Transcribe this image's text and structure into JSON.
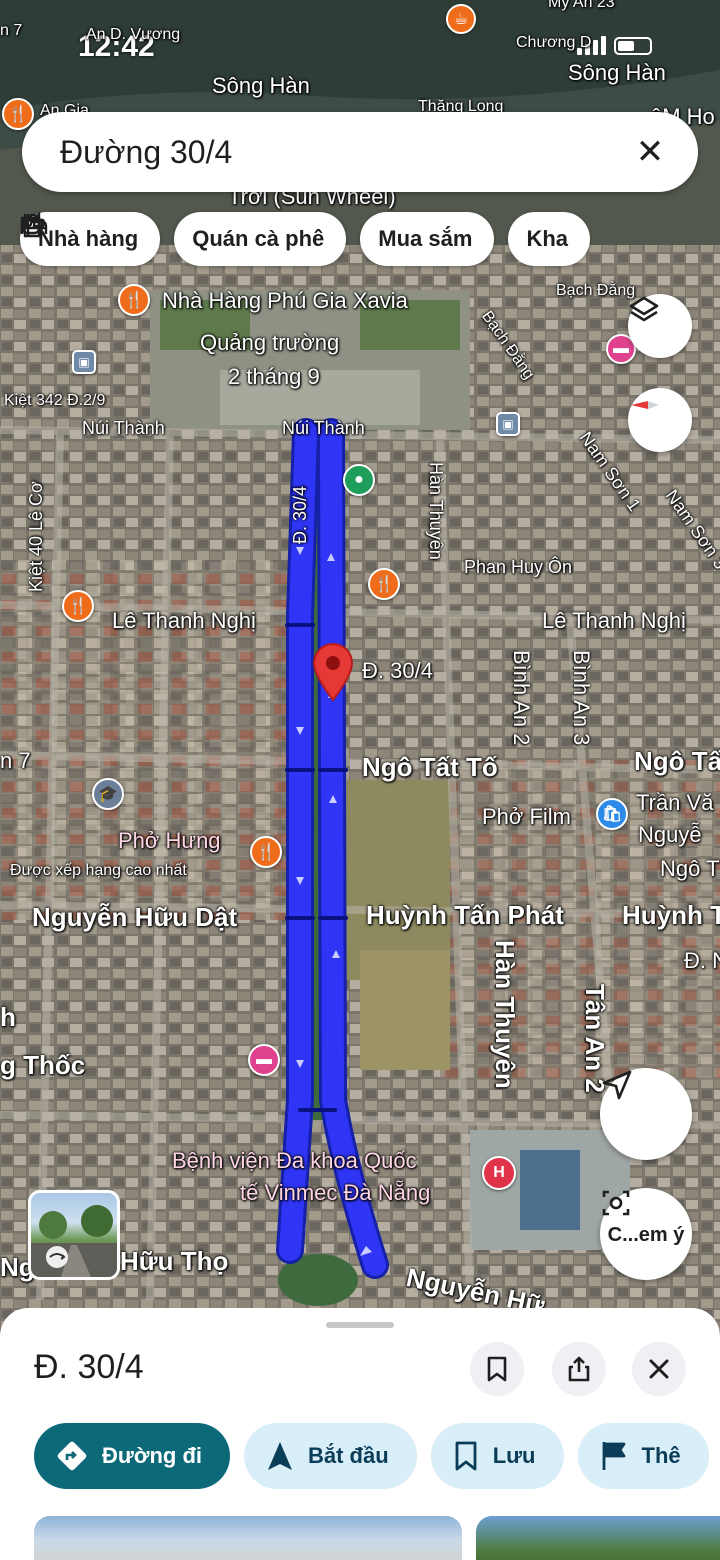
{
  "status": {
    "time": "12:42"
  },
  "search": {
    "query": "Đường 30/4",
    "clear_label": "✕"
  },
  "chips": [
    {
      "label": "Nhà hàng",
      "icon": "restaurant-icon"
    },
    {
      "label": "Quán cà phê",
      "icon": "coffee-icon"
    },
    {
      "label": "Mua sắm",
      "icon": "shopping-bag-icon"
    },
    {
      "label": "Kha",
      "icon": "bed-icon"
    }
  ],
  "map_labels": {
    "song_han_left": "Sông Hàn",
    "song_han_right": "Sông Hàn",
    "an_d_vuong": "An D. Vương",
    "my_an": "Mỹ An 23",
    "chuong_d": "Chương D",
    "an7_top": "n 7",
    "sun_wheel": "Trời (Sun Wheel)",
    "nha_hang_phu_gia": "Nhà Hàng Phú Gia Xavia",
    "bach_dang_top": "Bạch Đằng",
    "bach_dang_vert": "Bạch Đằng",
    "quang_truong_1": "Quảng trường",
    "quang_truong_2": "2 tháng 9",
    "kiet342": "Kiệt 342 Đ.2/9",
    "nui_thanh_left": "Núi Thành",
    "nui_thanh_center": "Núi Thành",
    "d304_vert": "Đ. 30/4",
    "kiet40": "Kiệt 40 Lê Cơ",
    "han_thuyen_top": "Hàn Thuyên",
    "nam_son_1": "Nam Sơn 1",
    "nam_son_3": "Nam Sơn 3",
    "phan_huy_on": "Phan Huy Ôn",
    "le_thanh_nghi_left": "Lê Thanh Nghị",
    "le_thanh_nghi_right": "Lê Thanh Nghị",
    "binh_an_2": "Bình An 2",
    "binh_an_3": "Bình An 3",
    "d304_pin": "Đ. 30/4",
    "an7_mid": "n 7",
    "ngo_tat_to": "Ngô Tất Tố",
    "ngo_tat_right": "Ngô Tấ",
    "pho_film": "Phở Film",
    "tran_va": "Trần Vă",
    "nguye": "Nguyễ",
    "ngo_t": "Ngô T",
    "pho_hung": "Phở Hưng",
    "duoc_xep_hang": "Được xếp hạng cao nhất",
    "nguyen_huu_dat": "Nguyễn Hữu Dật",
    "huynh_tan_phat": "Huỳnh Tấn Phát",
    "huynh_right": "Huỳnh T",
    "d_right": "Đ. N",
    "han_thuyen_bottom": "Hàn Thuyên",
    "tan_an": "Tân An 2",
    "g_thoc": "g Thốc",
    "h_left": "h",
    "benh_vien_1": "Bệnh viện Đa khoa Quốc",
    "benh_vien_2": "tế Vinmec Đà Nẵng",
    "huu_tho": "Hữu Thọ",
    "ng_left": "Ng",
    "nguyen_hu": "Nguyễn Hữ",
    "am_ho": "êM Ho",
    "an_gia": "An Gia",
    "thang_long": "Thăng Long"
  },
  "lens": {
    "label": "C...em ý"
  },
  "sheet": {
    "place_name": "Đ. 30/4",
    "actions": [
      {
        "label": "Đường đi",
        "icon": "directions-icon"
      },
      {
        "label": "Bắt đầu",
        "icon": "navigation-arrow-icon"
      },
      {
        "label": "Lưu",
        "icon": "bookmark-icon"
      },
      {
        "label": "Thê",
        "icon": "flag-icon"
      }
    ]
  },
  "colors": {
    "route": "#2f35f5",
    "route_dark": "#1620a8",
    "pin": "#e53935",
    "primary_action": "#0c6a78",
    "secondary_action": "#d8eef8"
  }
}
